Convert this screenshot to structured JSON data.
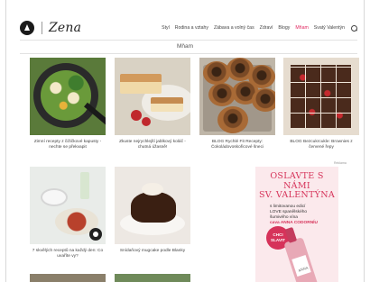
{
  "brand": {
    "logo_text": "Zena"
  },
  "nav": {
    "items": [
      {
        "label": "Styl",
        "active": false
      },
      {
        "label": "Rodina a vztahy",
        "active": false
      },
      {
        "label": "Zábava a volný čas",
        "active": false
      },
      {
        "label": "Zdraví",
        "active": false
      },
      {
        "label": "Blogy",
        "active": false
      },
      {
        "label": "Mňam",
        "active": true
      },
      {
        "label": "Svatý Valentýn",
        "active": false
      }
    ],
    "accent_color": "#e0245e"
  },
  "page": {
    "title": "Mňam"
  },
  "articles": [
    {
      "caption": "Zimní recepty z čižičkové kapusty - nechte se překvapit",
      "image": "pan-dish"
    },
    {
      "caption": "Zkuste nejrychlejší jablkový koláč - chutná úžasně!",
      "image": "apple-cake"
    },
    {
      "caption": "BLOG Rychlé Fit Recepty: Čokoládovoskořicové šneci",
      "image": "cinnamon-buns"
    },
    {
      "caption": "BLOG Bezcukrcukle: Brownies z červené řepy",
      "image": "brownies"
    },
    {
      "caption": "7 skvělých receptů na každý den: Co uvaříte vy?",
      "image": "plated-meal"
    },
    {
      "caption": "Snídaňový mugcake podle Blanky",
      "image": "mug-cake"
    }
  ],
  "ad": {
    "label": "Reklama",
    "headline_1": "OSLAVTE S NÁMI",
    "headline_2": "SV. VALENTÝNA",
    "body_1": "s limitovanou edicí",
    "body_2": "LOVE spanělského",
    "body_3": "šumivého vína",
    "body_bold": "cava ANNA CODORNÍU",
    "cta_1": "CHCI",
    "cta_2": "SLAVIT",
    "brand": "ANNA",
    "accent_color": "#d6335a"
  }
}
